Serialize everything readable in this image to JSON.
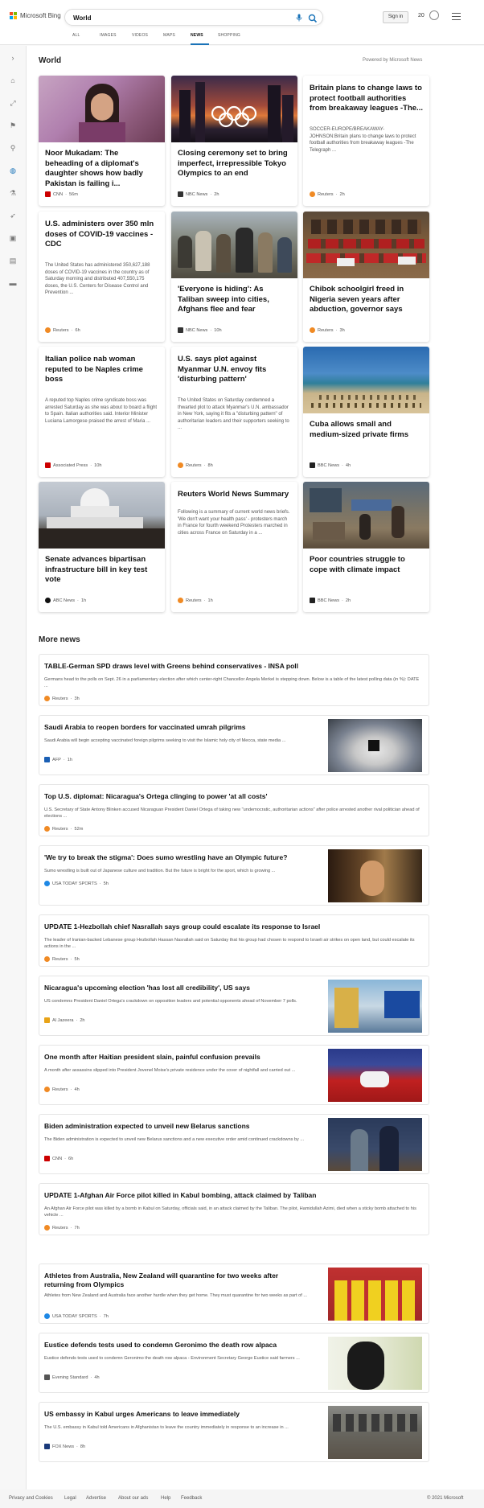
{
  "header": {
    "logo_text": "Microsoft Bing",
    "search_value": "World",
    "signin_label": "Sign in",
    "rewards_count": "20",
    "tabs": [
      "ALL",
      "IMAGES",
      "VIDEOS",
      "MAPS",
      "NEWS",
      "SHOPPING"
    ],
    "active_tab": "NEWS"
  },
  "sidebar": {
    "icons": [
      "expand-icon",
      "home-icon",
      "trending-icon",
      "flag-icon",
      "location-icon",
      "globe-icon",
      "science-icon",
      "rocket-icon",
      "movie-icon",
      "briefcase-icon",
      "card-icon"
    ]
  },
  "world": {
    "title": "World",
    "powered_by": "Powered by Microsoft News"
  },
  "cards": [
    {
      "title": "Noor Mukadam: The beheading of a diplomat's daughter shows how badly Pakistan is failing i...",
      "desc": "",
      "source": "CNN",
      "time": "56m",
      "src_color": "#cc0000"
    },
    {
      "title": "Closing ceremony set to bring imperfect, irrepressible Tokyo Olympics to an end",
      "desc": "",
      "source": "NBC News",
      "time": "2h",
      "src_color": "#333333"
    },
    {
      "title": "Britain plans to change laws to protect football authorities from breakaway leagues -The...",
      "desc": "SOCCER-EUROPE/BREAKAWAY-JOHNSON:Britain plans to change laws to protect football authorities from breakaway leagues -The Telegraph ...",
      "source": "Reuters",
      "time": "2h",
      "src_color": "#f08a24"
    },
    {
      "title": "U.S. administers over 350 mln doses of COVID-19 vaccines - CDC",
      "desc": "The United States has administered 350,627,188 doses of COVID-19 vaccines in the country as of Saturday morning and distributed 407,550,175 doses, the U.S. Centers for Disease Control and Prevention ...",
      "source": "Reuters",
      "time": "6h",
      "src_color": "#f08a24"
    },
    {
      "title": "'Everyone is hiding': As Taliban sweep into cities, Afghans flee and fear",
      "desc": "",
      "source": "NBC News",
      "time": "10h",
      "src_color": "#333333"
    },
    {
      "title": "Chibok schoolgirl freed in Nigeria seven years after abduction, governor says",
      "desc": "",
      "source": "Reuters",
      "time": "3h",
      "src_color": "#f08a24"
    },
    {
      "title": "Italian police nab woman reputed to be Naples crime boss",
      "desc": "A reputed top Naples crime syndicate boss was arrested Saturday as she was about to board a flight to Spain. Italian authorities said. Interior Minister Luciana Lamorgese praised the arrest of Maria ...",
      "source": "Associated Press",
      "time": "10h",
      "src_color": "#cc0000"
    },
    {
      "title": "U.S. says plot against Myanmar U.N. envoy fits 'disturbing pattern'",
      "desc": "The United States on Saturday condemned a thwarted plot to attack Myanmar's U.N. ambassador in New York, saying it fits a \"disturbing pattern\" of authoritarian leaders and their supporters seeking to ...",
      "source": "Reuters",
      "time": "8h",
      "src_color": "#f08a24"
    },
    {
      "title": "Cuba allows small and medium-sized private firms",
      "desc": "",
      "source": "BBC News",
      "time": "4h",
      "src_color": "#222222"
    },
    {
      "title": "Senate advances bipartisan infrastructure bill in key test vote",
      "desc": "",
      "source": "ABC News",
      "time": "1h",
      "src_color": "#111111"
    },
    {
      "title": "Reuters World News Summary",
      "desc": "Following is a summary of current world news briefs. 'We don't want your health pass' - protesters march in France for fourth weekend Protesters marched in cities across France on Saturday in a ...",
      "source": "Reuters",
      "time": "1h",
      "src_color": "#f08a24"
    },
    {
      "title": "Poor countries struggle to cope with climate impact",
      "desc": "",
      "source": "BBC News",
      "time": "2h",
      "src_color": "#222222"
    }
  ],
  "more_news": {
    "title": "More news",
    "items": [
      {
        "title": "TABLE-German SPD draws level with Greens behind conservatives - INSA poll",
        "desc": "Germans head to the polls on Sept. 26 in a parliamentary election after which center-right Chancellor Angela Merkel is stepping down. Below is a table of the latest polling data (in %): DATE ...",
        "source": "Reuters",
        "time": "3h",
        "src_color": "#f08a24"
      },
      {
        "title": "Saudi Arabia to reopen borders for vaccinated umrah pilgrims",
        "desc": "Saudi Arabia will begin accepting vaccinated foreign pilgrims seeking to visit the Islamic holy city of Mecca, state media ...",
        "source": "AFP",
        "time": "1h",
        "src_color": "#1a5fb4"
      },
      {
        "title": "Top U.S. diplomat: Nicaragua's Ortega clinging to power 'at all costs'",
        "desc": "U.S. Secretary of State Antony Blinken accused Nicaraguan President Daniel Ortega of taking new \"undemocratic, authoritarian actions\" after police arrested another rival politician ahead of elections ...",
        "source": "Reuters",
        "time": "52m",
        "src_color": "#f08a24"
      },
      {
        "title": "'We try to break the stigma': Does sumo wrestling have an Olympic future?",
        "desc": "Sumo wrestling is built out of Japanese culture and tradition. But the future is bright for the sport, which is growing ...",
        "source": "USA TODAY SPORTS",
        "time": "5h",
        "src_color": "#1e88e5"
      },
      {
        "title": "UPDATE 1-Hezbollah chief Nasrallah says group could escalate its response to Israel",
        "desc": "The leader of Iranian-backed Lebanese group Hezbollah Hassan Nasrallah said on Saturday that his group had chosen to respond to Israeli air strikes on open land, but could escalate its actions in the ...",
        "source": "Reuters",
        "time": "5h",
        "src_color": "#f08a24"
      },
      {
        "title": "Nicaragua's upcoming election 'has lost all credibility', US says",
        "desc": "US condemns President Daniel Ortega's crackdown on opposition leaders and potential opponents ahead of November 7 polls.",
        "source": "Al Jazeera",
        "time": "2h",
        "src_color": "#e8a317"
      },
      {
        "title": "One month after Haitian president slain, painful confusion prevails",
        "desc": "A month after assassins slipped into President Jovenel Moise's private residence under the cover of nightfall and carried out ...",
        "source": "Reuters",
        "time": "4h",
        "src_color": "#f08a24"
      },
      {
        "title": "Biden administration expected to unveil new Belarus sanctions",
        "desc": "The Biden administration is expected to unveil new Belarus sanctions and a new executive order amid continued crackdowns by ...",
        "source": "CNN",
        "time": "6h",
        "src_color": "#cc0000"
      },
      {
        "title": "UPDATE 1-Afghan Air Force pilot killed in Kabul bombing, attack claimed by Taliban",
        "desc": "An Afghan Air Force pilot was killed by a bomb in Kabul on Saturday, officials said, in an attack claimed by the Taliban. The pilot, Hamidullah Azimi, died when a sticky bomb attached to his vehicle ...",
        "source": "Reuters",
        "time": "7h",
        "src_color": "#f08a24"
      },
      {
        "title": "Athletes from Australia, New Zealand will quarantine for two weeks after returning from Olympics",
        "desc": "Athletes from New Zealand and Australia face another hurdle when they get home. They must quarantine for two weeks as part of ...",
        "source": "USA TODAY SPORTS",
        "time": "7h",
        "src_color": "#1e88e5"
      },
      {
        "title": "Eustice defends tests used to condemn Geronimo the death row alpaca",
        "desc": "Eustice defends tests used to condemn Geronimo the death row alpaca - Environment Secretary George Eustice said farmers ...",
        "source": "Evening Standard",
        "time": "4h",
        "src_color": "#555555"
      },
      {
        "title": "US embassy in Kabul urges Americans to leave immediately",
        "desc": "The U.S. embassy in Kabul told Americans in Afghanistan to leave the country immediately in response to an increase in ...",
        "source": "FOX News",
        "time": "8h",
        "src_color": "#1a3a7a"
      }
    ]
  },
  "footer": {
    "links": [
      "Privacy and Cookies",
      "Legal",
      "Advertise",
      "About our ads",
      "Help",
      "Feedback"
    ],
    "copyright": "© 2021 Microsoft"
  }
}
